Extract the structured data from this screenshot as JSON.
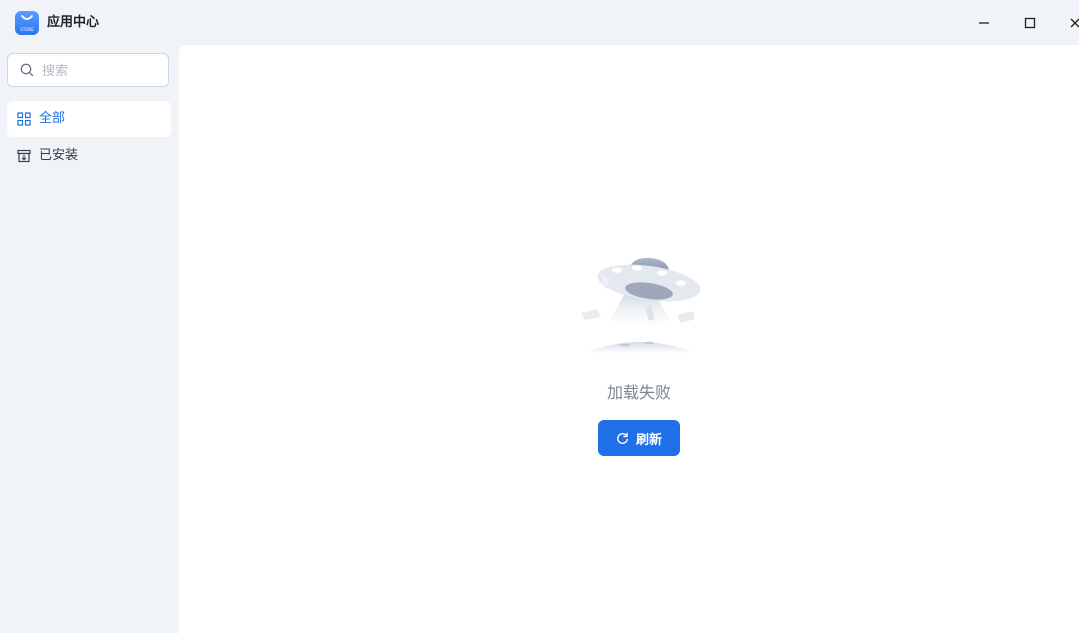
{
  "app": {
    "title": "应用中心",
    "icon": "store-bag-icon",
    "icon_text": "STORE"
  },
  "window_controls": {
    "minimize": "minimize-icon",
    "maximize": "maximize-icon",
    "close": "close-icon"
  },
  "sidebar": {
    "search": {
      "placeholder": "搜索",
      "value": ""
    },
    "items": [
      {
        "label": "全部",
        "icon": "grid-icon",
        "active": true
      },
      {
        "label": "已安装",
        "icon": "installed-box-icon",
        "active": false
      }
    ]
  },
  "main": {
    "illustration": "ufo-illustration",
    "error_message": "加载失败",
    "refresh_label": "刷新",
    "refresh_icon": "refresh-icon"
  },
  "colors": {
    "accent": "#1f6fe6",
    "active_text": "#1e6fe0",
    "sidebar_bg": "#f0f3f8",
    "content_bg": "#ffffff",
    "muted_text": "#7d8594"
  }
}
